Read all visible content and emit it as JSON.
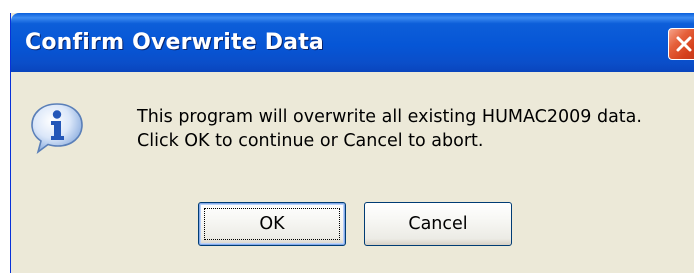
{
  "window": {
    "title": "Confirm Overwrite Data"
  },
  "icons": {
    "message_icon": "information-icon",
    "close_icon": "close-icon"
  },
  "message": {
    "line1": "This program will overwrite all existing HUMAC2009 data.",
    "line2": "Click OK to continue or Cancel to abort."
  },
  "buttons": {
    "ok_label": "OK",
    "cancel_label": "Cancel"
  },
  "colors": {
    "titlebar": "#0656d6",
    "dialog_background": "#ece9d8",
    "close_button": "#d5401c"
  }
}
